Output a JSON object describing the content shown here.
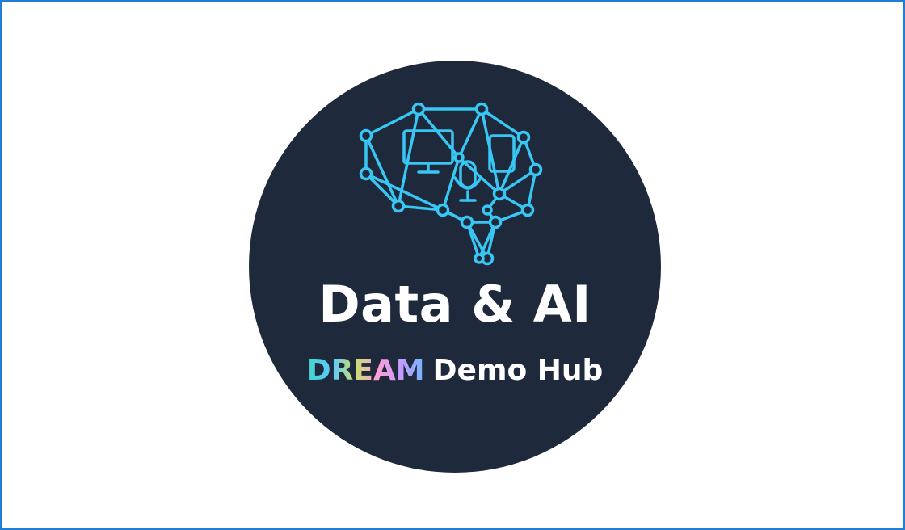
{
  "logo": {
    "title": "Data & AI",
    "subtitle_highlight": "DREAM",
    "subtitle_rest": "Demo Hub",
    "icon": "brain-network-icon",
    "colors": {
      "circle": "#1e293b",
      "accent": "#38c6f4",
      "text": "#ffffff",
      "border": "#1f7fd6"
    }
  }
}
